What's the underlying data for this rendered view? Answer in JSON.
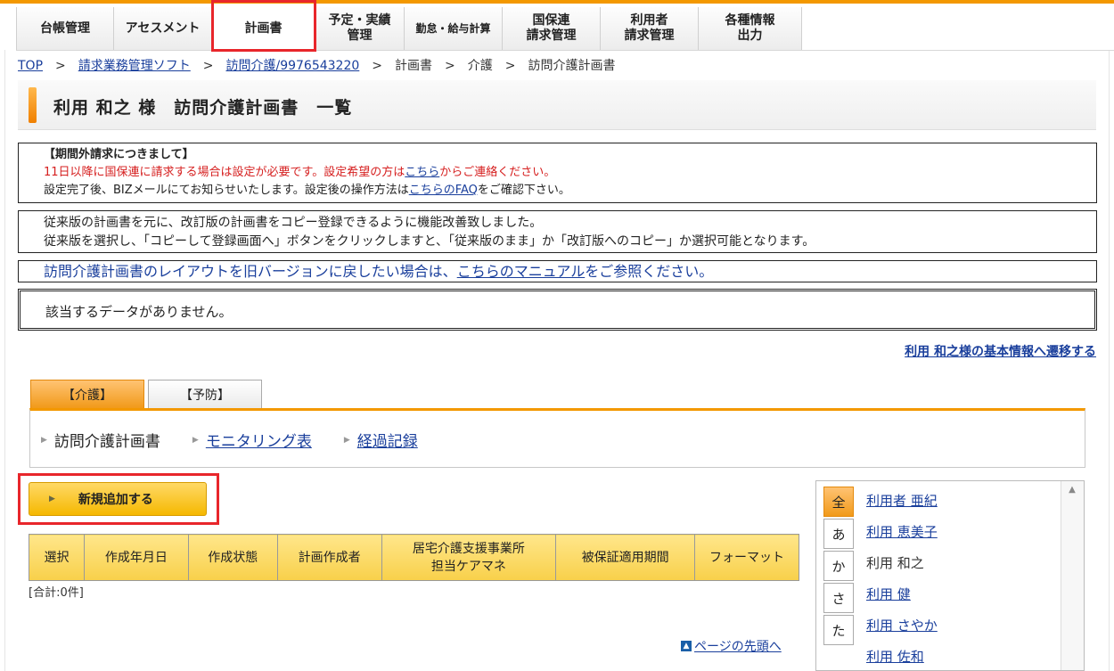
{
  "nav": {
    "items": [
      {
        "label": "台帳管理"
      },
      {
        "label": "アセスメント"
      },
      {
        "label": "計画書"
      },
      {
        "label": "予定・実績\n管理"
      },
      {
        "label": "勤怠・給与計算"
      },
      {
        "label": "国保連\n請求管理"
      },
      {
        "label": "利用者\n請求管理"
      },
      {
        "label": "各種情報\n出力"
      }
    ]
  },
  "breadcrumb": {
    "top": "TOP",
    "software": "請求業務管理ソフト",
    "service": "訪問介護/9976543220",
    "plan": "計画書",
    "care": "介護",
    "current": "訪問介護計画書",
    "sep": ">"
  },
  "page_title": "利用 和之 様　訪問介護計画書　一覧",
  "notice1": {
    "heading": "【期間外請求につきまして】",
    "line1_pre": "11日以降に国保連に請求する場合は設定が必要です。設定希望の方は",
    "line1_link": "こちら",
    "line1_post": "からご連絡ください。",
    "line2_pre": "設定完了後、BIZメールにてお知らせいたします。設定後の操作方法は",
    "line2_link": "こちらのFAQ",
    "line2_post": "をご確認下さい。"
  },
  "notice2": {
    "line1": "従来版の計画書を元に、改訂版の計画書をコピー登録できるように機能改善致しました。",
    "line2": "従来版を選択し、「コピーして登録画面へ」ボタンをクリックしますと、「従来版のまま」か「改訂版へのコピー」か選択可能となります。"
  },
  "notice3": {
    "pre": "訪問介護計画書のレイアウトを旧バージョンに戻したい場合は、",
    "link": "こちらのマニュアル",
    "post": "をご参照ください。"
  },
  "no_data": "該当するデータがありません。",
  "basic_info_link": "利用 和之様の基本情報へ遷移する",
  "tabs": [
    {
      "label": "【介護】"
    },
    {
      "label": "【予防】"
    }
  ],
  "subnav": {
    "current": "訪問介護計画書",
    "monitoring": "モニタリング表",
    "progress": "経過記録"
  },
  "add_button": "新規追加する",
  "table": {
    "headers": [
      "選択",
      "作成年月日",
      "作成状態",
      "計画作成者",
      "居宅介護支援事業所\n担当ケアマネ",
      "被保証適用期間",
      "フォーマット"
    ]
  },
  "total": "[合計:0件]",
  "page_top": "ページの先頭へ",
  "kana": [
    "全",
    "あ",
    "か",
    "さ",
    "た"
  ],
  "users": [
    {
      "name": "利用者 亜紀",
      "link": true
    },
    {
      "name": "利用 恵美子",
      "link": true
    },
    {
      "name": "利用 和之",
      "link": false
    },
    {
      "name": "利用 健",
      "link": true
    },
    {
      "name": "利用 さやか",
      "link": true
    },
    {
      "name": "利用 佐和",
      "link": true
    }
  ],
  "colors": {
    "accent": "#f39800",
    "highlight_box": "#e8262b",
    "link": "#1a3f9c",
    "notice_red": "#d62020",
    "button_yellow": "#f5b800"
  }
}
